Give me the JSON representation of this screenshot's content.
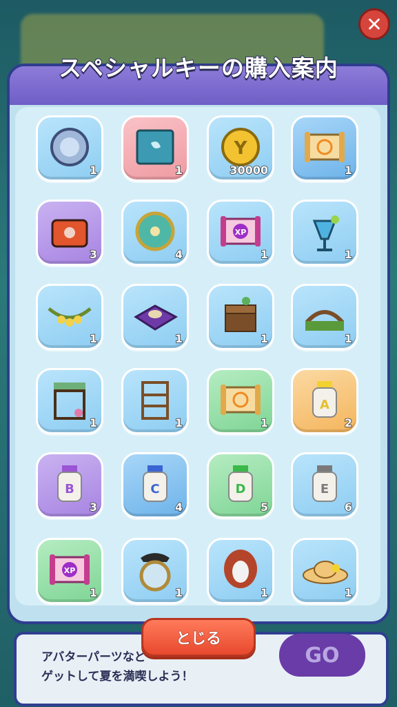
{
  "dialog": {
    "title": "スペシャルキーの購入案内",
    "close_label": "とじる"
  },
  "background": {
    "line1": "アバターパーツなど",
    "line2": "ゲットして夏を満喫しよう！",
    "go_label": "GO"
  },
  "items": [
    {
      "name": "medal-icon",
      "count": "1",
      "bg": "bg-blue"
    },
    {
      "name": "book-icon",
      "count": "1",
      "bg": "bg-red"
    },
    {
      "name": "coin-icon",
      "count": "30000",
      "bg": "bg-blue"
    },
    {
      "name": "scroll-y-icon",
      "count": "1",
      "bg": "bg-blueblue"
    },
    {
      "name": "chest-icon",
      "count": "3",
      "bg": "bg-purple"
    },
    {
      "name": "star-medal-icon",
      "count": "4",
      "bg": "bg-blue"
    },
    {
      "name": "xp-scroll-icon",
      "count": "1",
      "bg": "bg-blue"
    },
    {
      "name": "drink-icon",
      "count": "1",
      "bg": "bg-blue"
    },
    {
      "name": "garland-icon",
      "count": "1",
      "bg": "bg-blue"
    },
    {
      "name": "rug-icon",
      "count": "1",
      "bg": "bg-blue"
    },
    {
      "name": "desk-icon",
      "count": "1",
      "bg": "bg-blue"
    },
    {
      "name": "bridge-icon",
      "count": "1",
      "bg": "bg-blue"
    },
    {
      "name": "stall-icon",
      "count": "1",
      "bg": "bg-blue"
    },
    {
      "name": "shelf-icon",
      "count": "1",
      "bg": "bg-blue"
    },
    {
      "name": "scroll-y-icon",
      "count": "1",
      "bg": "bg-green"
    },
    {
      "name": "jar-a-icon",
      "count": "2",
      "bg": "bg-orange"
    },
    {
      "name": "jar-b-icon",
      "count": "3",
      "bg": "bg-purple"
    },
    {
      "name": "jar-c-icon",
      "count": "4",
      "bg": "bg-blueblue"
    },
    {
      "name": "jar-d-icon",
      "count": "5",
      "bg": "bg-green"
    },
    {
      "name": "jar-e-icon",
      "count": "6",
      "bg": "bg-blue"
    },
    {
      "name": "xp-scroll-icon",
      "count": "1",
      "bg": "bg-green"
    },
    {
      "name": "pirate-mirror-icon",
      "count": "1",
      "bg": "bg-blue"
    },
    {
      "name": "wig-icon",
      "count": "1",
      "bg": "bg-blue"
    },
    {
      "name": "hat-icon",
      "count": "1",
      "bg": "bg-blue"
    }
  ]
}
